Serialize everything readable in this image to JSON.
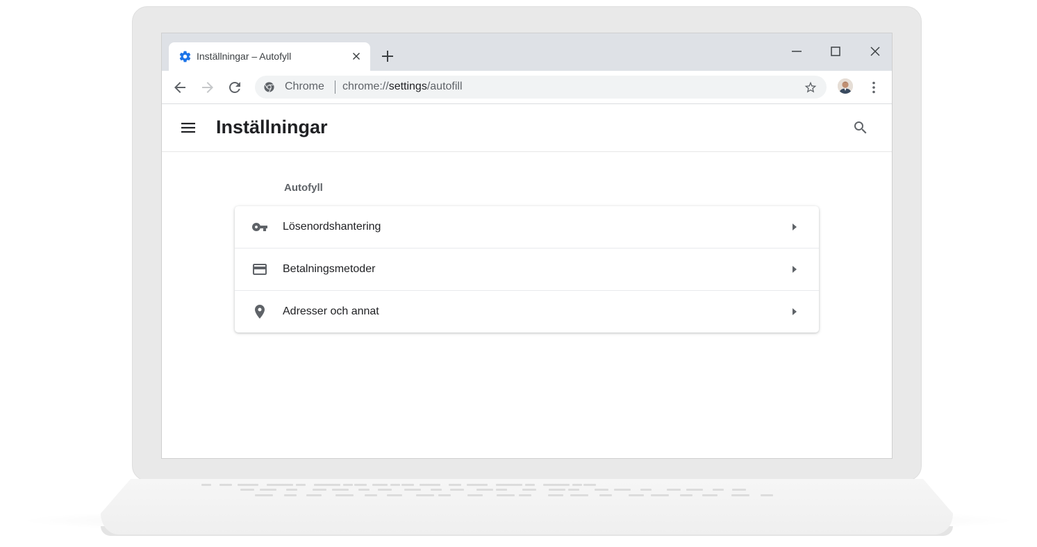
{
  "tab": {
    "title": "Inställningar – Autofyll",
    "favicon": "settings-gear-icon",
    "accent_color": "#1a73e8"
  },
  "omnibox": {
    "origin_label": "Chrome",
    "url_prefix": "chrome://",
    "url_host": "settings",
    "url_path": "/autofill"
  },
  "header": {
    "title": "Inställningar"
  },
  "autofill": {
    "section_title": "Autofyll",
    "items": [
      {
        "label": "Lösenordshantering",
        "icon": "key-icon"
      },
      {
        "label": "Betalningsmetoder",
        "icon": "credit-card-icon"
      },
      {
        "label": "Adresser och annat",
        "icon": "location-pin-icon"
      }
    ]
  },
  "colors": {
    "tabstrip": "#dee1e6",
    "omnibox": "#f1f3f4",
    "icon_gray": "#5f6368",
    "text": "#202124"
  }
}
